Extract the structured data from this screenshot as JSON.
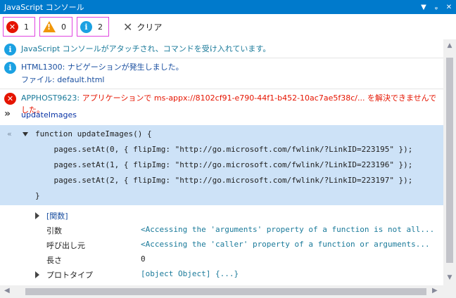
{
  "window": {
    "title": "JavaScript コンソール",
    "buttons": [
      "▼",
      "ᵩ",
      "✕"
    ]
  },
  "toolbar": {
    "errors": "1",
    "warnings": "0",
    "messages": "2",
    "clear_label": "クリア"
  },
  "messages": [
    {
      "text": "JavaScript コンソールがアタッチされ、コマンドを受け入れています。"
    },
    {
      "line1": "HTML1300: ナビゲーションが発生しました。",
      "line2": "ファイル: default.html"
    },
    {
      "code": "APPHOST9623:",
      "text": "アプリケーションで ms-appx://8102cf91-e790-44f1-b452-10ac7ae5f38c/... を解決できませんでした。"
    }
  ],
  "input": {
    "command": "updateImages"
  },
  "code": {
    "lines": [
      "function updateImages() {",
      "    pages.setAt(0, { flipImg: \"http://go.microsoft.com/fwlink/?LinkID=223195\" });",
      "    pages.setAt(1, { flipImg: \"http://go.microsoft.com/fwlink/?LinkID=223196\" });",
      "    pages.setAt(2, { flipImg: \"http://go.microsoft.com/fwlink/?LinkID=223197\" });",
      "}"
    ]
  },
  "properties": [
    {
      "name": "[関数]",
      "value": ""
    },
    {
      "name": "引数",
      "value": "<Accessing the 'arguments' property of a function is not all..."
    },
    {
      "name": "呼び出し元",
      "value": "<Accessing the 'caller' property of a function or arguments..."
    },
    {
      "name": "長さ",
      "value": "0"
    },
    {
      "name": "プロトタイプ",
      "value": "[object Object] {...}"
    }
  ]
}
